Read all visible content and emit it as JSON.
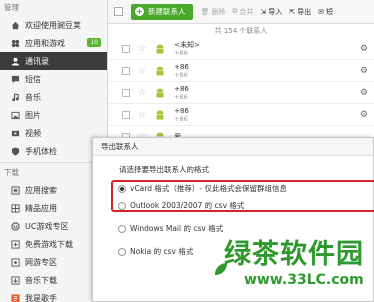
{
  "sidebar": {
    "section1": "管理",
    "items": [
      {
        "label": "欢迎使用豌豆荚",
        "icon": "home-icon"
      },
      {
        "label": "应用和游戏",
        "icon": "apps-icon",
        "badge": "10"
      },
      {
        "label": "通讯录",
        "icon": "contacts-icon",
        "active": true
      },
      {
        "label": "短信",
        "icon": "message-icon"
      },
      {
        "label": "音乐",
        "icon": "music-icon"
      },
      {
        "label": "图片",
        "icon": "image-icon"
      },
      {
        "label": "视频",
        "icon": "video-icon"
      },
      {
        "label": "手机体检",
        "icon": "shield-icon"
      }
    ],
    "section2": "下载",
    "section2_right": "⊕",
    "items2": [
      {
        "label": "应用搜索",
        "icon": "list-icon"
      },
      {
        "label": "精品应用",
        "icon": "grid-icon"
      },
      {
        "label": "UC游戏专区",
        "icon": "uc-icon"
      },
      {
        "label": "免费游戏下载",
        "icon": "game-icon"
      },
      {
        "label": "网游专区",
        "icon": "gamepad-icon"
      },
      {
        "label": "音乐下载",
        "icon": "music-download-icon"
      },
      {
        "label": "我是歌手",
        "icon": "singer-icon"
      }
    ]
  },
  "toolbar": {
    "new_contact": "新建联系人",
    "delete": "删除",
    "merge": "合并",
    "import": "导入",
    "export": "导出",
    "sms": "短"
  },
  "count_text": "共 154 个联系人",
  "contacts": [
    {
      "name": "<未知>",
      "phone": "+86"
    },
    {
      "name": "+86",
      "phone": "+86"
    },
    {
      "name": "+86",
      "phone": "+86"
    },
    {
      "name": "+86",
      "phone": "+86"
    },
    {
      "name": "爱",
      "phone": ""
    }
  ],
  "dialog": {
    "title": "导出联系人",
    "prompt": "请选择要导出联系人的格式",
    "options": [
      {
        "label": "vCard 格式（推荐）- 仅此格式会保留群组信息",
        "selected": true
      },
      {
        "label": "Outlook 2003/2007 的 csv 格式",
        "selected": false
      },
      {
        "label": "Windows Mail 的 csv 格式",
        "selected": false
      },
      {
        "label": "Nokia 的 csv 格式",
        "selected": false
      }
    ]
  },
  "watermark": {
    "title": "绿茶软件园",
    "url": "www.33LC.com"
  },
  "colors": {
    "accent": "#4aa82d",
    "sidebar_active": "#3c3c3c",
    "highlight": "#d3242c",
    "watermark": "#2e9a2d"
  }
}
